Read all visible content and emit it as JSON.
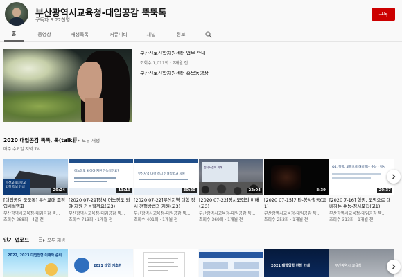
{
  "channel": {
    "title": "부산광역시교육청-대입공감 뚝뚝톡",
    "subscribers": "구독자 3.22천명",
    "subscribe_label": "구독"
  },
  "tabs": [
    {
      "label": "홈",
      "active": true
    },
    {
      "label": "동영상"
    },
    {
      "label": "재생목록"
    },
    {
      "label": "커뮤니티"
    },
    {
      "label": "채널"
    },
    {
      "label": "정보"
    }
  ],
  "featured": {
    "title": "부산진로진학지원센터 업무 안내",
    "meta": "조회수 1,011회 · 7개월 전",
    "description": "부산진로진학지원센터 홍보동영상"
  },
  "section1": {
    "title": "2020 대입공감 뚝뚝, 톡(talk)",
    "play_all": "모두 재생",
    "subtitle": "매주 수요일 저녁 7시",
    "videos": [
      {
        "title": "[대입공감 뚝뚝톡] 부산교대 조정 입시설명회",
        "channel": "부산광역시교육청-대입공감 뚝...",
        "meta": "조회수 268회 · 4일 전",
        "duration": "29:24",
        "thumb_text": "부산교육대학교 입학 정보 안내"
      },
      {
        "title": "[2020 07-29]정시 어느정도 되야 지원 가능할까요(고3)",
        "channel": "부산광역시교육청-대입공감 뚝...",
        "meta": "조회수 713회 · 1개월 전",
        "duration": "13:19",
        "thumb_text": "어느정도 되어야 지원 가능할까요?"
      },
      {
        "title": "[2020 07-22]부산지역 대학 정시 전형방법과 지원(고3)",
        "channel": "부산광역시교육청-대입공감 뚝...",
        "meta": "조회수 401회 · 1개월 전",
        "duration": "30:20",
        "thumb_text": "부산지역 대학 정시 전형방법과 지원"
      },
      {
        "title": "[2020 07-22]정시모집의 이해(고3)",
        "channel": "부산광역시교육청-대입공감 뚝...",
        "meta": "조회수 369회 · 1개월 전",
        "duration": "22:04",
        "thumb_text": "정시모집의 이해"
      },
      {
        "title": "[2020 07-15]기타-봉사활동(고1)",
        "channel": "부산광역시교육청-대입공감 뚝...",
        "meta": "조회수 253회 · 1개월 전",
        "duration": "8:39"
      },
      {
        "title": "[2020 7-16] 학평, 모평으로 대비하는 수능-정시포집(고1)",
        "channel": "부산광역시교육청-대입공감 뚝...",
        "meta": "조회수 313회 · 1개월 전",
        "duration": "20:37",
        "thumb_text": "Q4. 학평, 모평으로 대비하는 수능 · 정시"
      }
    ]
  },
  "section2": {
    "title": "인기 업로드",
    "play_all": "모두 재생",
    "thumbs": [
      {
        "text": "2022, 2023 대입전형 이해와 준비"
      },
      {
        "text": "2021 대입 기초편"
      },
      {
        "text": ""
      },
      {
        "text": ""
      },
      {
        "text": "2021 대학입학 전형 안내"
      },
      {
        "text": "부산광역시 교육청"
      }
    ]
  },
  "icons": {
    "search": "search-icon",
    "next": "chevron-right-icon",
    "play_all": "play-all-icon"
  }
}
